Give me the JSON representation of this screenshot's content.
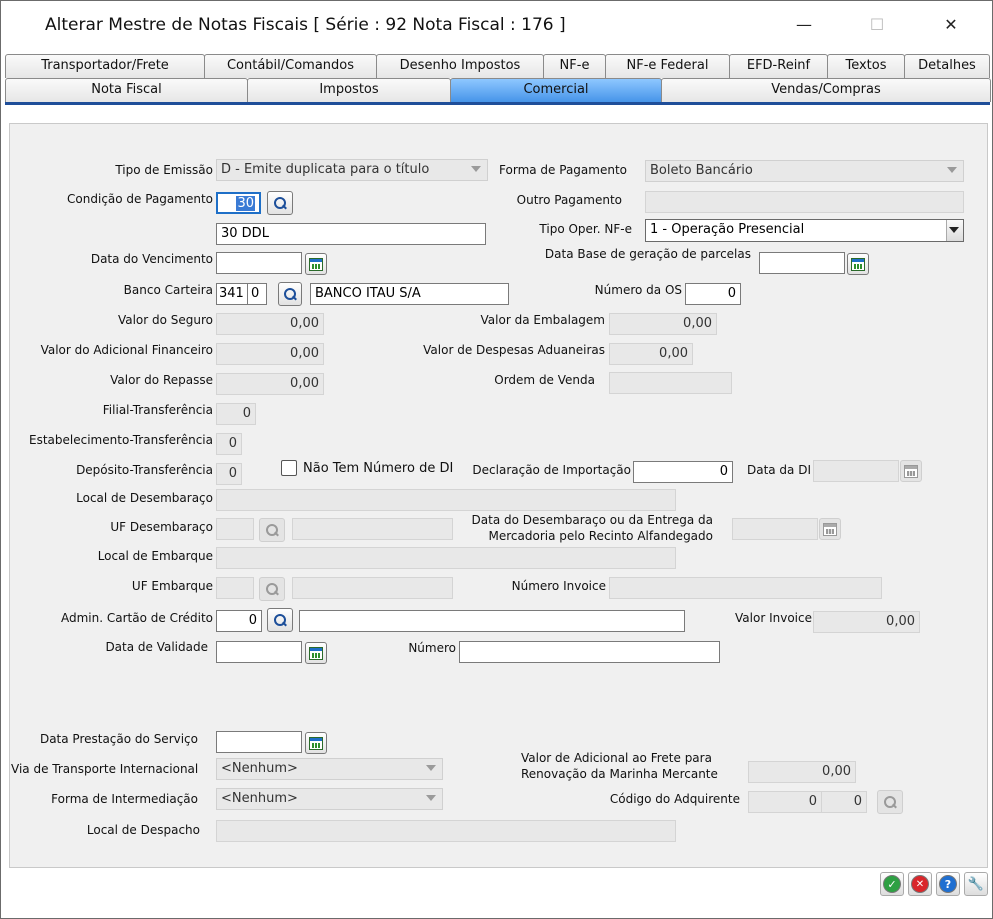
{
  "window": {
    "title": "Alterar Mestre de Notas Fiscais [ Série : 92  Nota Fiscal : 176 ]",
    "minimize": "—",
    "maximize": "☐",
    "close": "✕"
  },
  "tabs_row1": [
    "Transportador/Frete",
    "Contábil/Comandos",
    "Desenho Impostos",
    "NF-e",
    "NF-e Federal",
    "EFD-Reinf",
    "Textos",
    "Detalhes"
  ],
  "tabs_row2": [
    "Nota Fiscal",
    "Impostos",
    "Comercial",
    "Vendas/Compras"
  ],
  "fields": {
    "tipo_emissao": {
      "label": "Tipo de Emissão",
      "value": "D - Emite duplicata para o título"
    },
    "forma_pagamento": {
      "label": "Forma de Pagamento",
      "value": "Boleto Bancário"
    },
    "condicao_pagamento": {
      "label": "Condição de Pagamento",
      "value": "30",
      "desc": "30 DDL"
    },
    "outro_pagamento": {
      "label": "Outro Pagamento",
      "value": ""
    },
    "tipo_oper": {
      "label": "Tipo Oper. NF-e",
      "value": "1 - Operação Presencial"
    },
    "data_vencimento": {
      "label": "Data do Vencimento",
      "value": ""
    },
    "data_base": {
      "label": "Data Base de geração de parcelas",
      "value": ""
    },
    "banco_carteira": {
      "label": "Banco Carteira",
      "banco": "341",
      "carteira": "0",
      "nome": "BANCO ITAU S/A"
    },
    "numero_os": {
      "label": "Número da OS",
      "value": "0"
    },
    "valor_seguro": {
      "label": "Valor do Seguro",
      "value": "0,00"
    },
    "valor_embalagem": {
      "label": "Valor da Embalagem",
      "value": "0,00"
    },
    "valor_adicional": {
      "label": "Valor do Adicional Financeiro",
      "value": "0,00"
    },
    "valor_despesas": {
      "label": "Valor de Despesas Aduaneiras",
      "value": "0,00"
    },
    "valor_repasse": {
      "label": "Valor do Repasse",
      "value": "0,00"
    },
    "ordem_venda": {
      "label": "Ordem de Venda",
      "value": ""
    },
    "filial": {
      "label": "Filial-Transferência",
      "value": "0"
    },
    "estabelecimento": {
      "label": "Estabelecimento-Transferência",
      "value": "0"
    },
    "deposito": {
      "label": "Depósito-Transferência",
      "value": "0"
    },
    "nao_tem_di": {
      "label": "Não Tem Número de DI"
    },
    "declaracao": {
      "label": "Declaração de Importação",
      "value": "0"
    },
    "data_di": {
      "label": "Data da DI",
      "value": ""
    },
    "local_desembaraco": {
      "label": "Local de Desembaraço",
      "value": ""
    },
    "uf_desembaraco": {
      "label": "UF Desembaraço",
      "value": ""
    },
    "data_desembaraco": {
      "label1": "Data do Desembaraço ou da Entrega da",
      "label2": "Mercadoria pelo Recinto Alfandegado",
      "value": ""
    },
    "local_embarque": {
      "label": "Local de Embarque",
      "value": ""
    },
    "uf_embarque": {
      "label": "UF Embarque",
      "value": ""
    },
    "numero_invoice": {
      "label": "Número Invoice",
      "value": ""
    },
    "admin_cartao": {
      "label": "Admin. Cartão de Crédito",
      "value": "0",
      "desc": ""
    },
    "valor_invoice": {
      "label": "Valor Invoice",
      "value": "0,00"
    },
    "data_validade": {
      "label": "Data de Validade",
      "value": ""
    },
    "numero": {
      "label": "Número",
      "value": ""
    },
    "data_prestacao": {
      "label": "Data Prestação do Serviço",
      "value": ""
    },
    "via_transporte": {
      "label": "Via de Transporte Internacional",
      "value": "<Nenhum>"
    },
    "valor_frete": {
      "label1": "Valor de Adicional ao Frete para",
      "label2": "Renovação da Marinha Mercante",
      "value": "0,00"
    },
    "forma_intermediacao": {
      "label": "Forma de Intermediação",
      "value": "<Nenhum>"
    },
    "codigo_adquirente": {
      "label": "Código do Adquirente",
      "v1": "0",
      "v2": "0"
    },
    "local_despacho": {
      "label": "Local de Despacho",
      "value": ""
    }
  },
  "footer": {
    "ok": "✓",
    "cancel": "✕",
    "help": "?",
    "tools": "🔧"
  }
}
